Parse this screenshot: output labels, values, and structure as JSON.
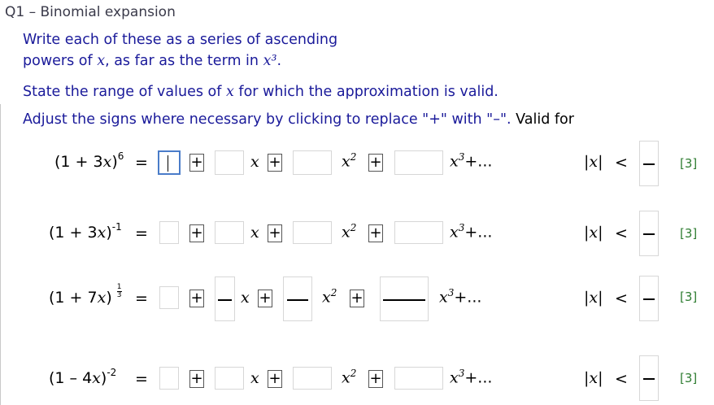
{
  "title": "Q1 – Binomial expansion",
  "instructions": {
    "line1": "Write each of these as a series of ascending",
    "line2_pre": "powers of ",
    "line2_mid": ", as far as the term in ",
    "line2_post": ".",
    "var": "x",
    "cube": "x³",
    "line3_pre": "State the range of values of ",
    "line3_post": " for which the approximation is valid.",
    "line4": "Adjust the signs where necessary by clicking to replace \"+\" with \"–\".",
    "valid_for": "Valid for"
  },
  "common": {
    "equals": "=",
    "plus": "+",
    "x": "x",
    "x2_base": "x",
    "x2_exp": "2",
    "x3_base": "x",
    "x3_exp": "3",
    "ellipsis": "+...",
    "abs_x": "|x|",
    "lt": "<",
    "marks": "[3]"
  },
  "rows": [
    {
      "base": "(1 + 3",
      "var": "x",
      "close": ")",
      "exp": "6"
    },
    {
      "base": "(1 + 3",
      "var": "x",
      "close": ")",
      "exp": "-1"
    },
    {
      "base": "(1 + 7",
      "var": "x",
      "close": ")",
      "exp_num": "1",
      "exp_den": "3"
    },
    {
      "base": "(1 – 4",
      "var": "x",
      "close": ")",
      "exp": "-2"
    }
  ],
  "inputs": {
    "row1": {
      "a": "",
      "b": "",
      "c": "",
      "d": ""
    },
    "row2": {
      "a": "",
      "b": "",
      "c": "",
      "d": ""
    },
    "row3": {
      "a": ""
    },
    "row4": {
      "a": "",
      "b": "",
      "c": "",
      "d": ""
    }
  }
}
